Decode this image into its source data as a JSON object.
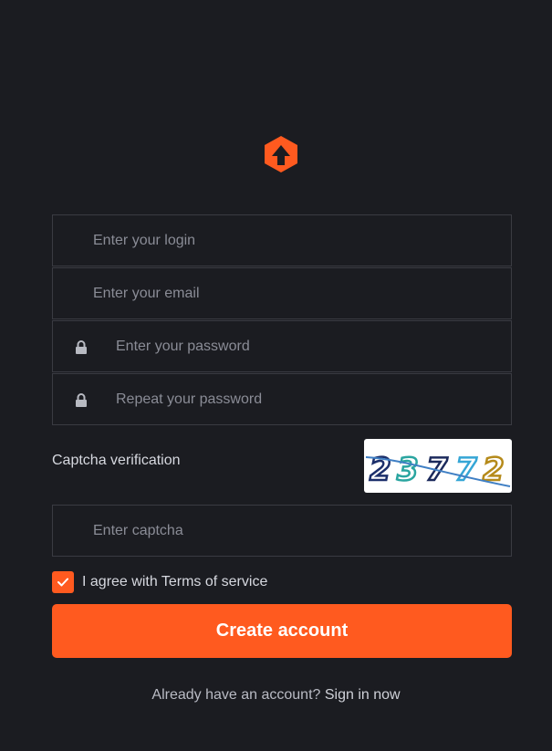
{
  "logo": {
    "icon": "home-arrow-logo-icon",
    "color": "#ff5a1f"
  },
  "form": {
    "login_placeholder": "Enter your login",
    "email_placeholder": "Enter your email",
    "password_placeholder": "Enter your password",
    "repeat_password_placeholder": "Repeat your password",
    "lock_icon": "lock-icon"
  },
  "captcha": {
    "label": "Captcha verification",
    "image_text": "23772",
    "input_placeholder": "Enter captcha"
  },
  "agreement": {
    "checked": true,
    "label": "I agree with Terms of service"
  },
  "create_button": {
    "label": "Create account",
    "color": "#ff5a1f"
  },
  "footer": {
    "prompt": "Already have an account?",
    "link_label": "Sign in now"
  },
  "colors": {
    "background": "#1b1c21",
    "border": "#3a3b42",
    "accent": "#ff5a1f"
  }
}
